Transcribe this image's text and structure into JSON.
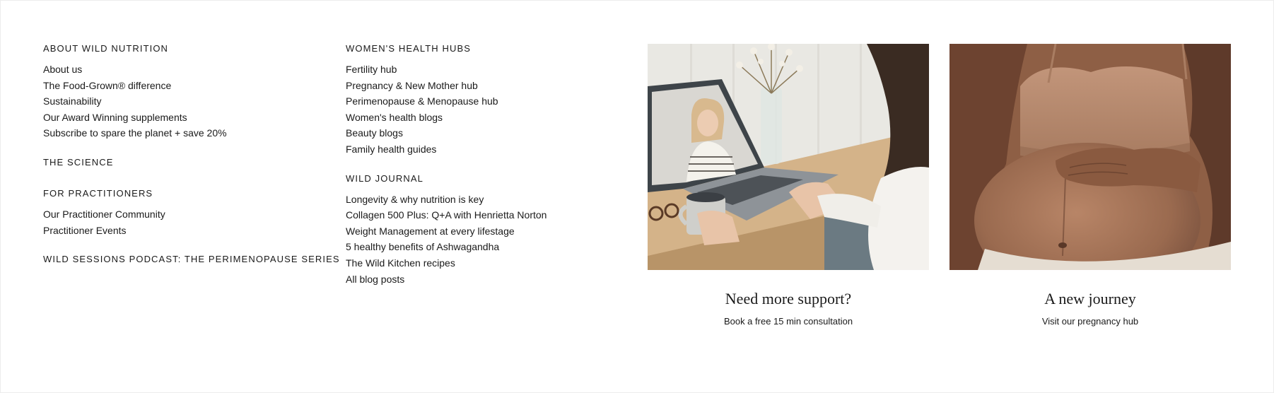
{
  "columns": {
    "about": {
      "heading": "ABOUT WILD NUTRITION",
      "links": [
        "About us",
        "The Food-Grown® difference",
        "Sustainability",
        "Our Award Winning supplements",
        "Subscribe to spare the planet + save 20%"
      ]
    },
    "science": {
      "heading": "THE SCIENCE"
    },
    "practitioners": {
      "heading": "FOR PRACTITIONERS",
      "links": [
        "Our Practitioner Community",
        "Practitioner Events"
      ]
    },
    "podcast": {
      "heading": "WILD SESSIONS PODCAST: THE PERIMENOPAUSE SERIES"
    },
    "womens_health": {
      "heading": "WOMEN'S HEALTH HUBS",
      "links": [
        "Fertility hub",
        "Pregnancy & New Mother hub",
        "Perimenopause & Menopause hub",
        "Women's health blogs",
        "Beauty blogs",
        "Family health guides"
      ]
    },
    "journal": {
      "heading": "WILD JOURNAL",
      "links": [
        "Longevity & why nutrition is key",
        "Collagen 500 Plus: Q+A with Henrietta Norton",
        "Weight Management at every lifestage",
        "5 healthy benefits of Ashwagandha",
        "The Wild Kitchen recipes",
        "All blog posts"
      ]
    }
  },
  "cards": [
    {
      "title": "Need more support?",
      "subtitle": "Book a free 15 min consultation"
    },
    {
      "title": "A new journey",
      "subtitle": "Visit our pregnancy hub"
    }
  ]
}
